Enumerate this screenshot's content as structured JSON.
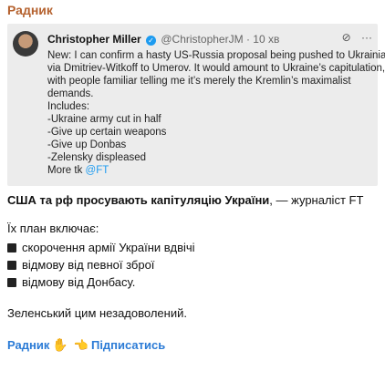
{
  "channel_title": "Радник",
  "tweet": {
    "author": "Christopher Miller",
    "handle": "@ChristopherJM",
    "separator": "·",
    "time": "10 хв",
    "lines": [
      "New: I can confirm a hasty US-Russia proposal being pushed to Ukrainians",
      "via Dmitriev-Witkoff to Umerov. It would amount to Ukraine’s capitulation,",
      "with people familiar telling me it’s merely the Kremlin’s maximalist",
      "demands.",
      "Includes:",
      "-Ukraine army cut in half",
      "-Give up certain weapons",
      "-Give up Donbas",
      "-Zelensky displeased"
    ],
    "more_prefix": "More tk ",
    "more_link": "@FT"
  },
  "message": {
    "headline_bold": "США та рф просувають капітуляцію України",
    "headline_rest": ", — журналіст FT",
    "plan_title": "Їх план включає:",
    "plan_items": [
      "скорочення армії України вдвічі",
      "відмову від певної зброї",
      "відмову від Донбасу."
    ],
    "summary": "Зеленський цим незадоволений."
  },
  "footer": {
    "channel_link": "Радник",
    "subscribe_link": "Підписатись"
  }
}
